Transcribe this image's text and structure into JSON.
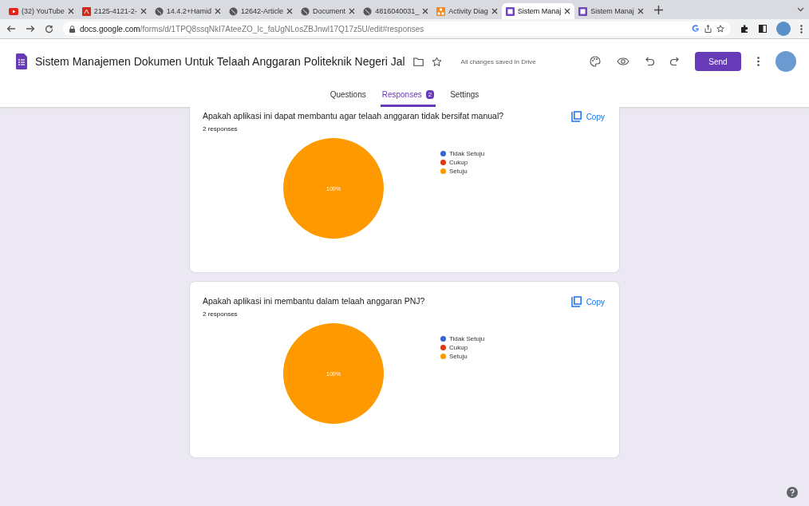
{
  "browser": {
    "tabs": [
      {
        "title": "(32) YouTube",
        "kind": "youtube",
        "selected": false
      },
      {
        "title": "2125-4121-2-",
        "kind": "pdf",
        "selected": false
      },
      {
        "title": "14.4.2+Hamid",
        "kind": "web",
        "selected": false
      },
      {
        "title": "12642-Article",
        "kind": "web",
        "selected": false
      },
      {
        "title": "Document",
        "kind": "web",
        "selected": false
      },
      {
        "title": "4816040031_",
        "kind": "web",
        "selected": false
      },
      {
        "title": "Activity Diag",
        "kind": "diagram",
        "selected": false
      },
      {
        "title": "Sistem Manaj",
        "kind": "forms",
        "selected": true
      },
      {
        "title": "Sistem Manaj",
        "kind": "forms",
        "selected": false
      }
    ],
    "url_host": "docs.google.com",
    "url_path": "/forms/d/1TPQ8ssqNkI7AteeZO_Ic_faUgNLosZBJnwl17Q17z5U/edit#responses"
  },
  "form": {
    "title": "Sistem Manajemen Dokumen Untuk Telaah Anggaran Politeknik Negeri Jal",
    "save_status": "All changes saved in Drive",
    "send": "Send",
    "tabs": [
      {
        "label": "Questions",
        "selected": false
      },
      {
        "label": "Responses",
        "badge": "2",
        "selected": true
      },
      {
        "label": "Settings",
        "selected": false
      }
    ]
  },
  "cards": [
    {
      "question": "Apakah aplikasi ini dapat membantu agar telaah anggaran tidak bersifat manual?",
      "responses": "2 responses",
      "copy": "Copy",
      "chart_data": {
        "type": "pie",
        "categories": [
          "Tidak Setuju",
          "Cukup",
          "Setuju"
        ],
        "values": [
          0,
          0,
          100
        ],
        "colors": [
          "#3366cc",
          "#dc3912",
          "#ff9900"
        ],
        "annotations": [
          "100%"
        ]
      }
    },
    {
      "question": "Apakah aplikasi ini membantu dalam telaah anggaran PNJ?",
      "responses": "2 responses",
      "copy": "Copy",
      "chart_data": {
        "type": "pie",
        "categories": [
          "Tidak Setuju",
          "Cukup",
          "Setuju"
        ],
        "values": [
          0,
          0,
          100
        ],
        "colors": [
          "#3366cc",
          "#dc3912",
          "#ff9900"
        ],
        "annotations": [
          "100%"
        ]
      }
    }
  ]
}
